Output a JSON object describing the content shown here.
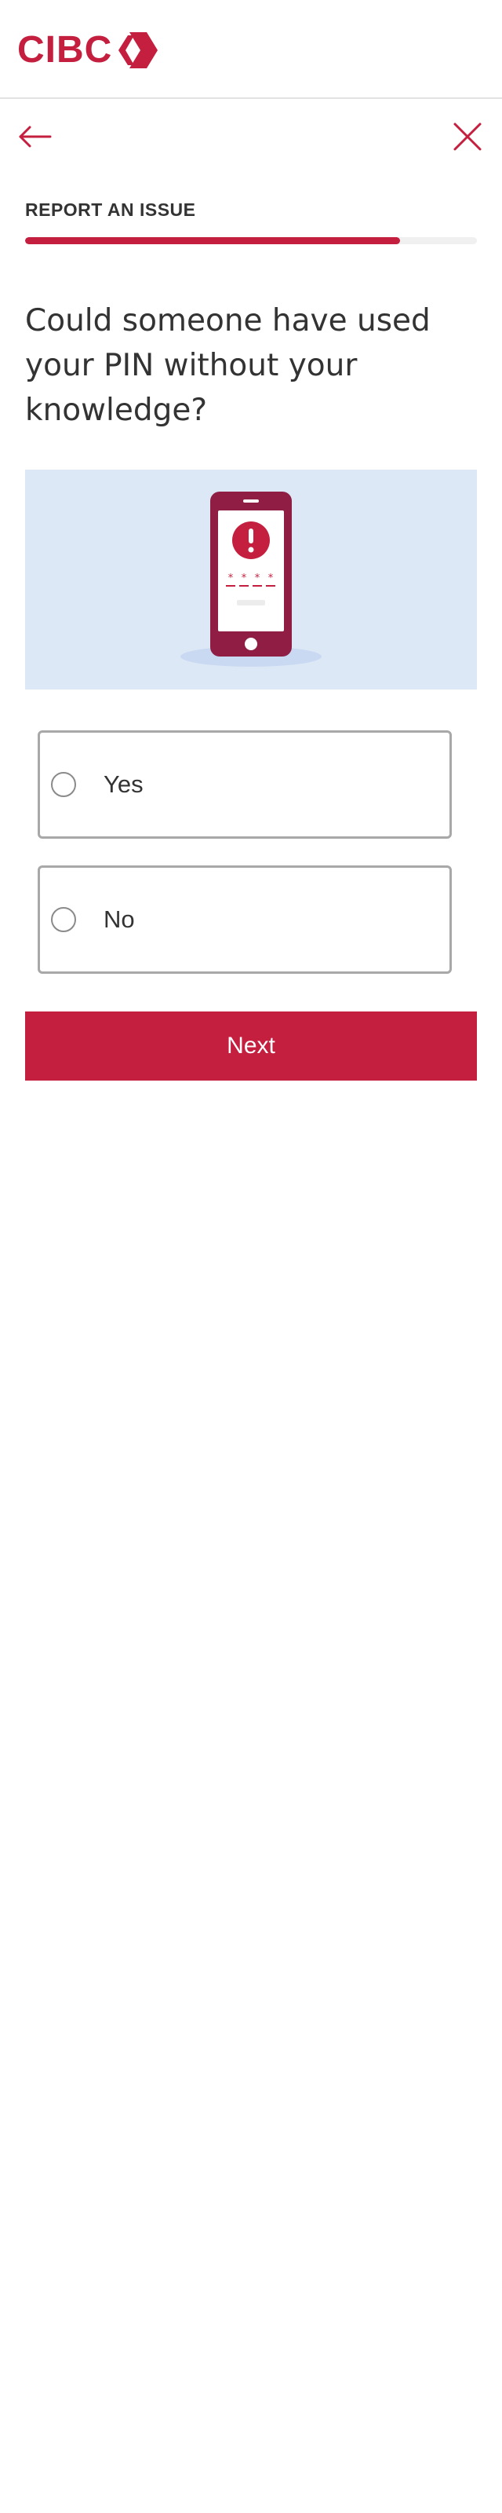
{
  "brand": {
    "name": "CIBC",
    "primary_color": "#c41f3e"
  },
  "nav": {
    "back_icon": "arrow-left-icon",
    "close_icon": "close-icon"
  },
  "flow": {
    "section_label": "REPORT AN ISSUE",
    "progress_fraction": 0.83
  },
  "question": {
    "text": "Could someone have used your PIN without your knowledge?"
  },
  "illustration": {
    "icon": "phone-pin-alert-icon",
    "background_color": "#dde8f7",
    "phone_color": "#8f1d44"
  },
  "options": [
    {
      "label": "Yes",
      "selected": false
    },
    {
      "label": "No",
      "selected": false
    }
  ],
  "actions": {
    "next_label": "Next"
  }
}
